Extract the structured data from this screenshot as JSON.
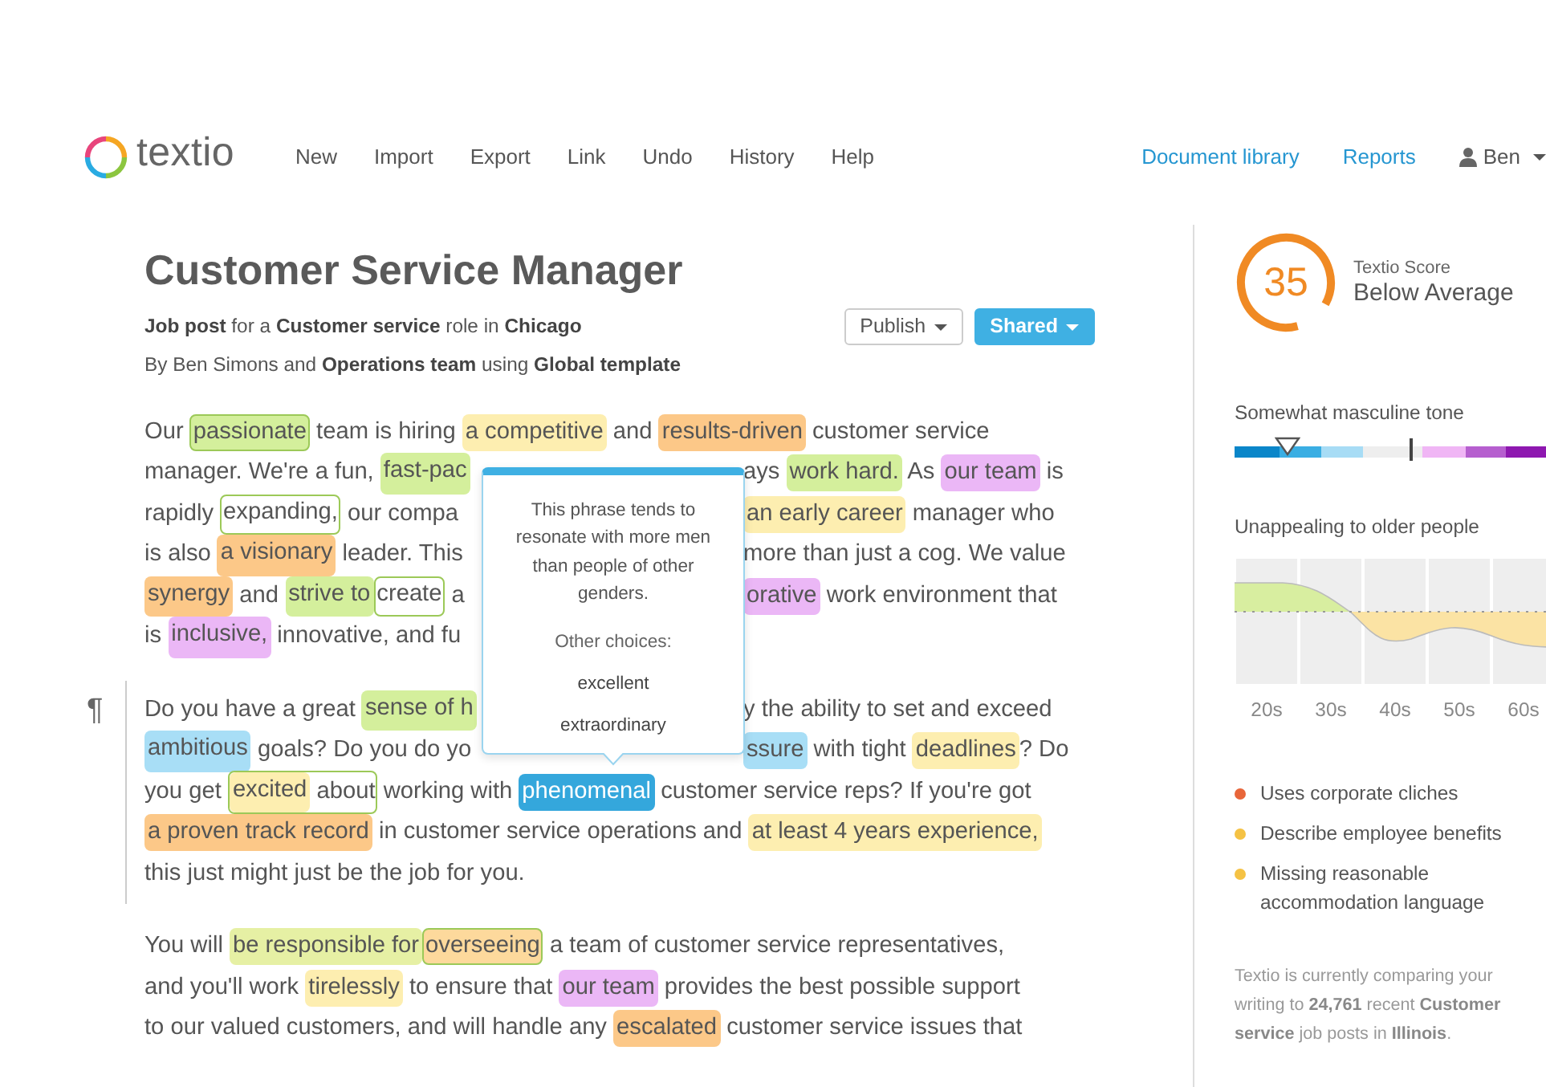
{
  "nav": {
    "logo_text": "textio",
    "menu": [
      "New",
      "Import",
      "Export",
      "Link",
      "Undo",
      "History",
      "Help"
    ],
    "links": [
      "Document library",
      "Reports"
    ],
    "user": "Ben"
  },
  "document": {
    "title": "Customer Service Manager",
    "meta": [
      "**Job post** for a **Customer service** role in **Chicago**",
      "By Ben Simons and **Operations team** using **Global template**"
    ],
    "buttons": [
      {
        "label": "Publish",
        "kind": "outline"
      },
      {
        "label": "Shared",
        "kind": "primary"
      }
    ]
  },
  "paragraphs": [
    {
      "lines": [
        {
          "kind": "full",
          "segments": [
            "Our ",
            {
              "text": "passionate",
              "color": "#d4ef9c",
              "outlined": true,
              "selected": false
            },
            " team is hiring ",
            {
              "text": "a competitive",
              "color": "#fdeeb0",
              "outlined": false,
              "selected": false
            },
            " and ",
            {
              "text": "results-driven",
              "color": "#fcc888",
              "outlined": false,
              "selected": false
            },
            " customer service"
          ]
        },
        {
          "kind": "split",
          "left": [
            "manager. We're a fun, ",
            {
              "text": "fast-pac",
              "color": "#d4ef9c",
              "outlined": false,
              "selected": false
            }
          ],
          "right": [
            "ays ",
            {
              "text": "work hard.",
              "color": "#d4ef9c",
              "outlined": false,
              "selected": false
            },
            " As ",
            {
              "text": "our team",
              "color": "#ebb7f6",
              "outlined": false,
              "selected": false
            },
            " is"
          ]
        },
        {
          "kind": "split",
          "left": [
            "rapidly ",
            {
              "text": "expanding,",
              "outlined": true,
              "selected": false
            },
            " our compa"
          ],
          "right": [
            {
              "text": "an early career",
              "color": "#fdeeb0",
              "outlined": false,
              "selected": false
            },
            " manager who"
          ]
        },
        {
          "kind": "split",
          "left": [
            "is also ",
            {
              "text": "a visionary",
              "color": "#fcc888",
              "outlined": false,
              "selected": false
            },
            " leader. This"
          ],
          "right": [
            "more than just a cog. We value"
          ]
        },
        {
          "kind": "split",
          "left": [
            {
              "text": "synergy",
              "color": "#fcc888",
              "outlined": false,
              "selected": false
            },
            " and ",
            {
              "text": "strive to",
              "color": "#d4ef9c",
              "outlined": false,
              "selected": false
            },
            {
              "text": "create",
              "outlined": true,
              "selected": false
            },
            " a"
          ],
          "right": [
            {
              "text": "orative",
              "color": "#ebb7f6",
              "outlined": false,
              "selected": false
            },
            " work environment that"
          ]
        },
        {
          "kind": "split",
          "left": [
            "is ",
            {
              "text": "inclusive,",
              "color": "#ebb7f6",
              "outlined": false,
              "selected": false
            },
            " innovative, and fu"
          ]
        }
      ]
    },
    {
      "mark": "¶",
      "lines": [
        {
          "kind": "split",
          "left": [
            "Do you have a great ",
            {
              "text": "sense of h",
              "color": "#d4ef9c",
              "outlined": false,
              "selected": false
            }
          ],
          "right": [
            "y the ability to set and exceed"
          ]
        },
        {
          "kind": "split",
          "left": [
            {
              "text": "ambitious",
              "color": "#a8def6",
              "outlined": false,
              "selected": false
            },
            " goals? Do you do yo"
          ],
          "right": [
            {
              "text": "ssure",
              "color": "#a8def6",
              "outlined": false,
              "selected": false
            },
            " with tight ",
            {
              "text": "deadlines",
              "color": "#fdeeb0",
              "outlined": false,
              "selected": false
            },
            "? Do"
          ]
        },
        {
          "kind": "full",
          "segments": [
            "you get ",
            {
              "outlined": true,
              "selected": false,
              "items": [
                {
                  "text": "excited",
                  "color": "#fdeeb0",
                  "outlined": false,
                  "selected": false
                },
                " about"
              ]
            },
            " working with ",
            {
              "text": "phenomenal",
              "color": "#34a7dc",
              "outlined": false,
              "selected": true
            },
            " customer service reps? If you're got"
          ]
        },
        {
          "kind": "full",
          "segments": [
            {
              "text": "a proven track record",
              "color": "#fcc888",
              "outlined": false,
              "selected": false
            },
            " in customer service operations and ",
            {
              "text": "at least 4 years experience,",
              "color": "#fdeeb0",
              "outlined": false,
              "selected": false
            }
          ]
        },
        {
          "kind": "full",
          "segments": [
            "this just might just be the job for you."
          ]
        }
      ]
    },
    {
      "lines": [
        {
          "kind": "full",
          "segments": [
            "You will ",
            {
              "text": "be responsible for",
              "color": "#e6f0a4",
              "outlined": false,
              "selected": false
            },
            {
              "text": "overseeing",
              "color": "#fdd99c",
              "outlined": true,
              "selected": false
            },
            " a team of customer service representatives,"
          ]
        },
        {
          "kind": "full",
          "segments": [
            "and you'll work ",
            {
              "text": "tirelessly",
              "color": "#fdeeb0",
              "outlined": false,
              "selected": false
            },
            " to ensure that ",
            {
              "text": "our team",
              "color": "#ebb7f6",
              "outlined": false,
              "selected": false
            },
            " provides the best possible support"
          ]
        },
        {
          "kind": "full",
          "segments": [
            "to our valued customers, and will handle any ",
            {
              "text": "escalated",
              "color": "#fcc888",
              "outlined": false,
              "selected": false
            },
            " customer service issues that"
          ]
        }
      ]
    }
  ],
  "popover": {
    "text": "This phrase tends to resonate with more men than people of other genders.",
    "choices_label": "Other choices:",
    "choices": [
      "excellent",
      "extraordinary"
    ]
  },
  "sidebar": {
    "score": {
      "value": "35",
      "label": "Textio Score",
      "rating": "Below Average"
    },
    "tone": {
      "label": "Somewhat masculine tone",
      "level": 0.17
    },
    "age": {
      "label": "Unappealing to older people",
      "axis_labels": [
        "20s",
        "30s",
        "40s",
        "50s",
        "60s"
      ]
    },
    "issues": [
      {
        "text": "Uses corporate cliches",
        "color": "#e8663a"
      },
      {
        "text": "Describe employee benefits",
        "color": "#f5c244"
      },
      {
        "text": "Missing reasonable accommodation language",
        "color": "#f5c244"
      }
    ],
    "note": "Textio is currently comparing your writing to **24,761** recent **Customer service** job posts in **Illinois**."
  }
}
